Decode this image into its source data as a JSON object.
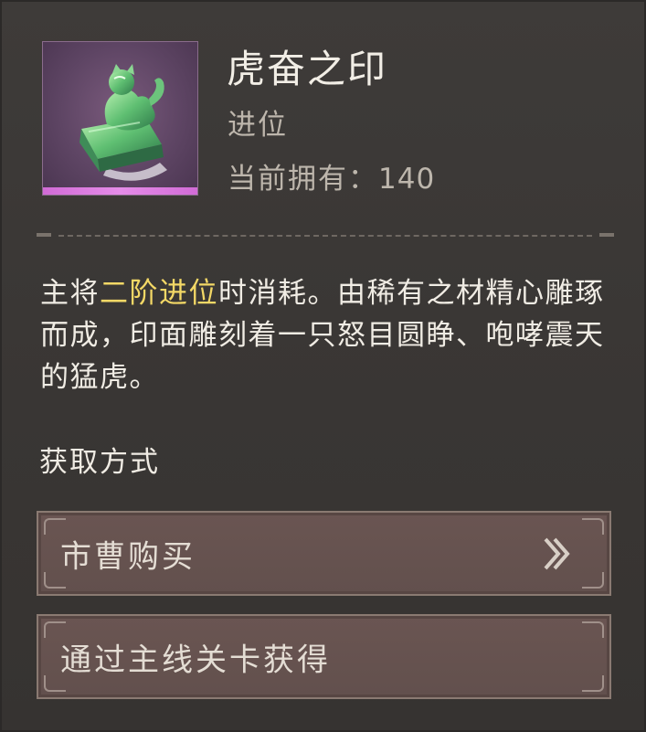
{
  "item": {
    "name": "虎奋之印",
    "category": "进位",
    "owned_label": "当前拥有：",
    "owned_count": "140",
    "icon": "jade-tiger-seal-icon",
    "rarity_color": "#e58ce8"
  },
  "description": {
    "prefix": "主将",
    "highlight": "二阶进位",
    "suffix": "时消耗。由稀有之材精心雕琢而成，印面雕刻着一只怒目圆睁、咆哮震天的猛虎。",
    "highlight_color": "#f3d866"
  },
  "acquire": {
    "title": "获取方式",
    "options": [
      {
        "label": "市曹购买",
        "arrow_icon": "double-chevron-right-icon"
      },
      {
        "label": "通过主线关卡获得"
      }
    ]
  }
}
